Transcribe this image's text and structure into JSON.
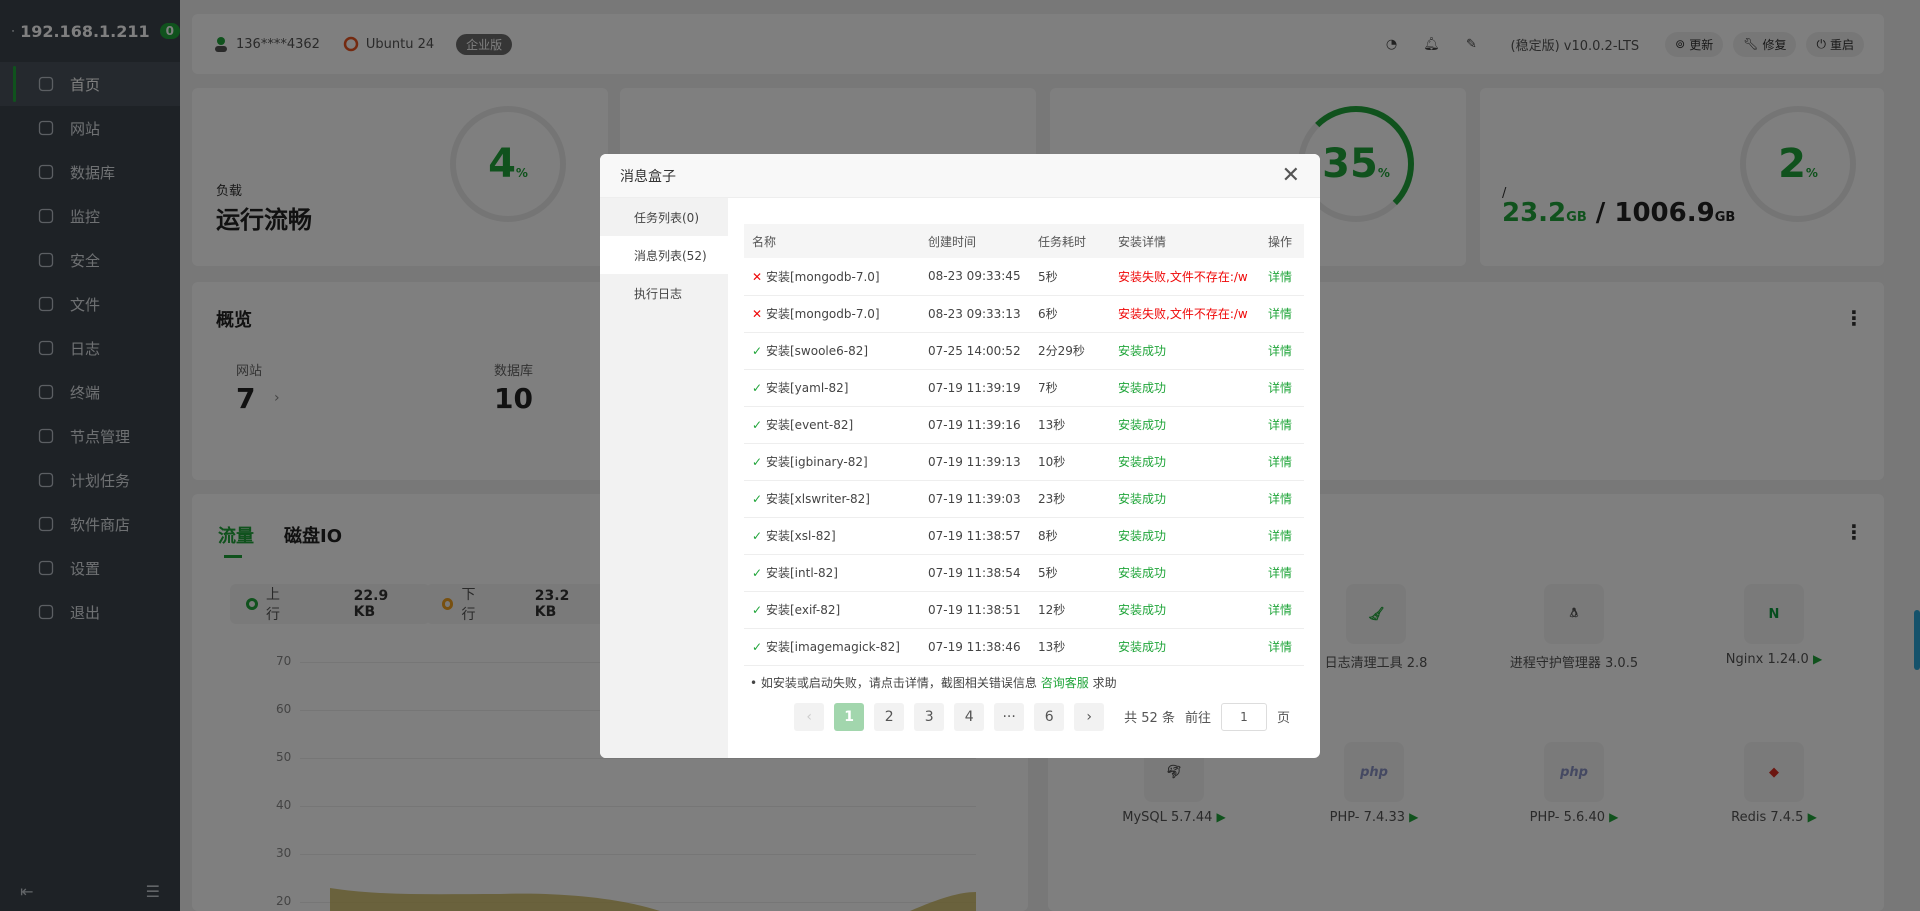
{
  "sidebar": {
    "host": "192.168.1.211",
    "badge": "0",
    "items": [
      {
        "label": "首页",
        "icon": "home-icon"
      },
      {
        "label": "网站",
        "icon": "globe-icon"
      },
      {
        "label": "数据库",
        "icon": "database-icon"
      },
      {
        "label": "监控",
        "icon": "monitor-icon"
      },
      {
        "label": "安全",
        "icon": "shield-icon"
      },
      {
        "label": "文件",
        "icon": "folder-icon"
      },
      {
        "label": "日志",
        "icon": "log-icon"
      },
      {
        "label": "终端",
        "icon": "terminal-icon"
      },
      {
        "label": "节点管理",
        "icon": "node-icon"
      },
      {
        "label": "计划任务",
        "icon": "calendar-icon"
      },
      {
        "label": "软件商店",
        "icon": "apps-icon"
      },
      {
        "label": "设置",
        "icon": "gear-icon"
      },
      {
        "label": "退出",
        "icon": "logout-icon"
      }
    ]
  },
  "topbar": {
    "user": "136****4362",
    "os": "Ubuntu 24",
    "edition": "企业版",
    "version": "(稳定版) v10.0.2-LTS",
    "update": "更新",
    "repair": "修复",
    "restart": "重启"
  },
  "stats": {
    "load_pct": "4",
    "load_label": "负载",
    "load_status": "运行流畅",
    "cpu_pct": "35",
    "disk_pct": "2",
    "disk_path": "/",
    "disk_used": "23.2",
    "disk_total": "1006.9",
    "unit_gb": "GB",
    "pct_unit": "%"
  },
  "overview": {
    "title": "概览",
    "site_label": "网站",
    "site_value": "7",
    "db_label": "数据库",
    "db_value": "10"
  },
  "traffic": {
    "tab_flow": "流量",
    "tab_disk": "磁盘IO",
    "up_label": "上行",
    "up_value": "22.9 KB",
    "down_label": "下行",
    "down_value": "23.2 KB",
    "yticks": [
      "70",
      "60",
      "50",
      "40",
      "30",
      "20"
    ]
  },
  "apps": [
    {
      "name": "日志清理工具 2.8"
    },
    {
      "name": "进程守护管理器 3.0.5"
    },
    {
      "name": "Nginx 1.24.0"
    },
    {
      "name": "MySQL 5.7.44"
    },
    {
      "name": "PHP- 7.4.33"
    },
    {
      "name": "PHP- 5.6.40"
    },
    {
      "name": "Redis 7.4.5"
    }
  ],
  "modal": {
    "title": "消息盒子",
    "tabs": [
      "任务列表(0)",
      "消息列表(52)",
      "执行日志"
    ],
    "columns": [
      "名称",
      "创建时间",
      "任务耗时",
      "安装详情",
      "操作"
    ],
    "rows": [
      {
        "ok": false,
        "name": "安装[mongodb-7.0]",
        "time": "08-23 09:33:45",
        "dur": "5秒",
        "detail": "安装失败,文件不存在:/w",
        "op": "详情"
      },
      {
        "ok": false,
        "name": "安装[mongodb-7.0]",
        "time": "08-23 09:33:13",
        "dur": "6秒",
        "detail": "安装失败,文件不存在:/w",
        "op": "详情"
      },
      {
        "ok": true,
        "name": "安装[swoole6-82]",
        "time": "07-25 14:00:52",
        "dur": "2分29秒",
        "detail": "安装成功",
        "op": "详情"
      },
      {
        "ok": true,
        "name": "安装[yaml-82]",
        "time": "07-19 11:39:19",
        "dur": "7秒",
        "detail": "安装成功",
        "op": "详情"
      },
      {
        "ok": true,
        "name": "安装[event-82]",
        "time": "07-19 11:39:16",
        "dur": "13秒",
        "detail": "安装成功",
        "op": "详情"
      },
      {
        "ok": true,
        "name": "安装[igbinary-82]",
        "time": "07-19 11:39:13",
        "dur": "10秒",
        "detail": "安装成功",
        "op": "详情"
      },
      {
        "ok": true,
        "name": "安装[xlswriter-82]",
        "time": "07-19 11:39:03",
        "dur": "23秒",
        "detail": "安装成功",
        "op": "详情"
      },
      {
        "ok": true,
        "name": "安装[xsl-82]",
        "time": "07-19 11:38:57",
        "dur": "8秒",
        "detail": "安装成功",
        "op": "详情"
      },
      {
        "ok": true,
        "name": "安装[intl-82]",
        "time": "07-19 11:38:54",
        "dur": "5秒",
        "detail": "安装成功",
        "op": "详情"
      },
      {
        "ok": true,
        "name": "安装[exif-82]",
        "time": "07-19 11:38:51",
        "dur": "12秒",
        "detail": "安装成功",
        "op": "详情"
      },
      {
        "ok": true,
        "name": "安装[imagemagick-82]",
        "time": "07-19 11:38:46",
        "dur": "13秒",
        "detail": "安装成功",
        "op": "详情"
      }
    ],
    "tip": "如安装或启动失败，请点击详情，截图相关错误信息",
    "tip_link": "咨询客服",
    "tip_suffix": "求助",
    "pager": {
      "pages": [
        "1",
        "2",
        "3",
        "4",
        "···",
        "6"
      ],
      "total": "共 52 条",
      "goto": "前往",
      "page_input": "1",
      "page_unit": "页"
    }
  },
  "colors": {
    "accent": "#20a53a",
    "error": "#ef0808",
    "sidebar_bg": "#3c444d"
  }
}
